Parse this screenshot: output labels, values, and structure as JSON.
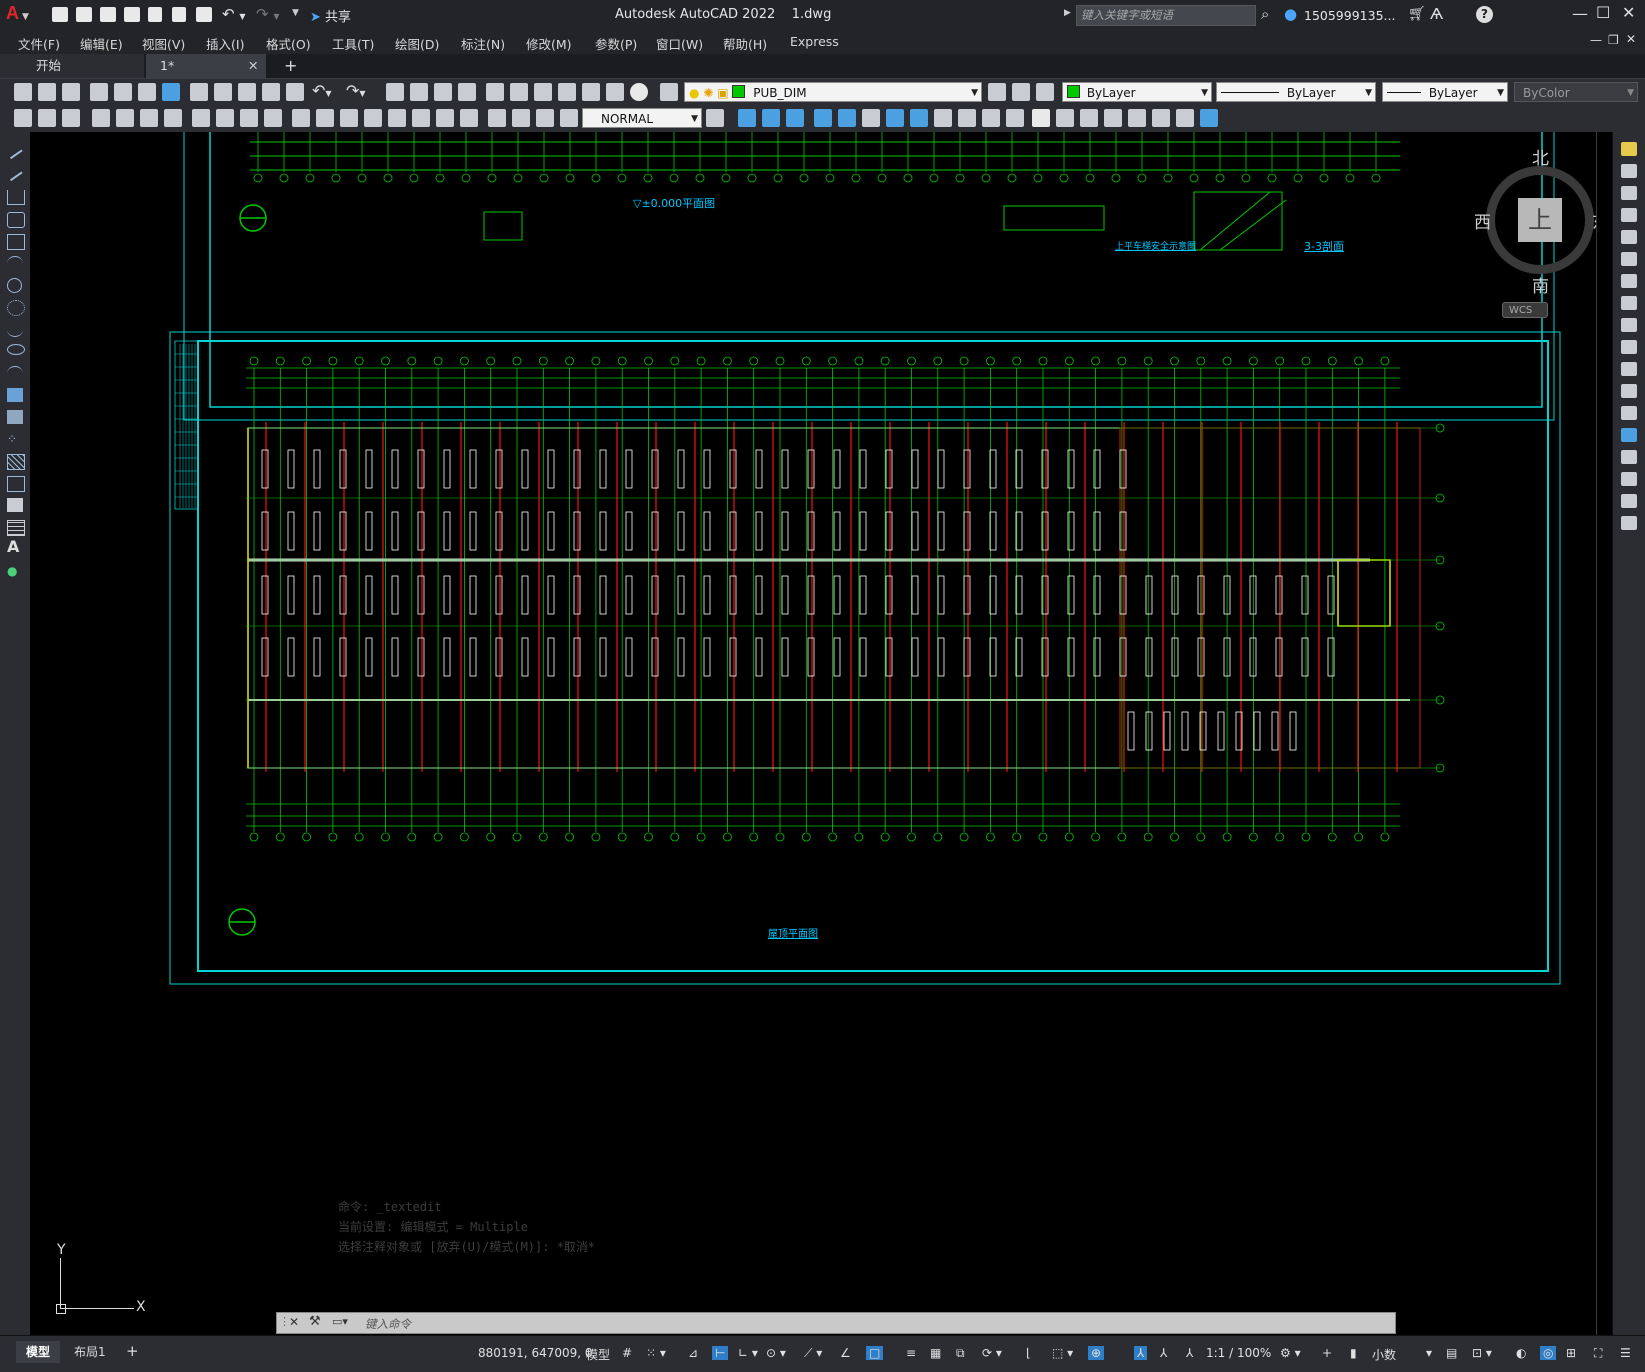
{
  "app": {
    "title": "Autodesk AutoCAD 2022    1.dwg",
    "share_label": "共享",
    "search_placeholder": "键入关键字或短语",
    "user": "1505999135...",
    "help": "?"
  },
  "menu": [
    "文件(F)",
    "编辑(E)",
    "视图(V)",
    "插入(I)",
    "格式(O)",
    "工具(T)",
    "绘图(D)",
    "标注(N)",
    "修改(M)",
    "参数(P)",
    "窗口(W)",
    "帮助(H)",
    "Express"
  ],
  "tabs": {
    "start": "开始",
    "active": "1*",
    "close": "✕",
    "add": "+"
  },
  "toolbar": {
    "layer": "PUB_DIM",
    "color": "ByLayer",
    "linetype": "ByLayer",
    "lineweight": "ByLayer",
    "plotstyle": "ByColor",
    "dimstyle": "NORMAL"
  },
  "viewcube": {
    "north": "北",
    "south": "南",
    "east": "东",
    "west": "西",
    "face": "上",
    "wcs": "WCS"
  },
  "ucs": {
    "x": "X",
    "y": "Y"
  },
  "drawing": {
    "plan_label": "屋顶平面图",
    "elev_label": "▽±0.000平面图",
    "detail_label": "3-3剖面",
    "note_label": "上平车梯安全示意图"
  },
  "command": {
    "history": [
      "命令: _textedit",
      "当前设置: 编辑模式 = Multiple",
      "选择注释对象或 [放弃(U)/模式(M)]: *取消*"
    ],
    "placeholder": "键入命令"
  },
  "status": {
    "model_tab": "模型",
    "layout_tab": "布局1",
    "add": "+",
    "coords": "880191, 647009, 0",
    "mode": "模型",
    "scale": "1:1 / 100%",
    "units": "小数"
  },
  "colors": {
    "canvas": "#000000",
    "frame": "#00d4d4",
    "grid": "#00c800",
    "red": "#e01010",
    "yellow": "#e8e800",
    "white": "#ffffff"
  }
}
